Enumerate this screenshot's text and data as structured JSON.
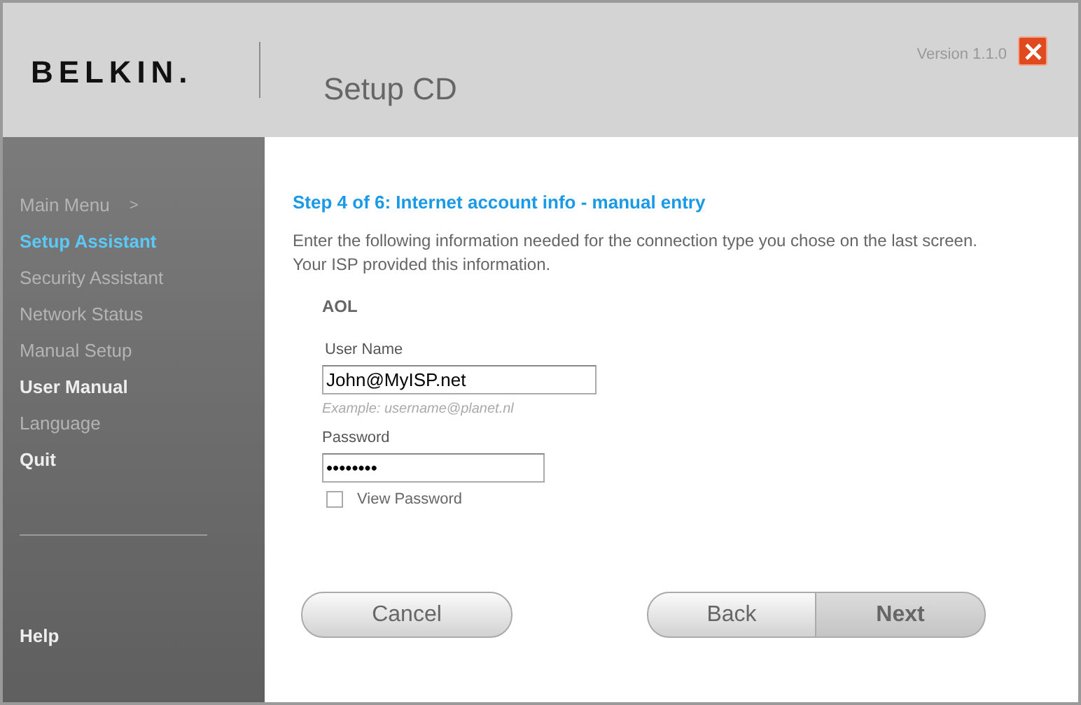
{
  "header": {
    "logo": "BELKIN.",
    "title": "Setup CD",
    "version": "Version 1.1.0"
  },
  "sidebar": {
    "items": [
      {
        "label": "Main Menu",
        "arrow": ">",
        "selected": false,
        "disabled": true
      },
      {
        "label": "Setup Assistant",
        "selected": true,
        "disabled": false
      },
      {
        "label": "Security Assistant",
        "selected": false,
        "disabled": true
      },
      {
        "label": "Network Status",
        "selected": false,
        "disabled": true
      },
      {
        "label": "Manual Setup",
        "selected": false,
        "disabled": true
      },
      {
        "label": "User Manual",
        "selected": false,
        "disabled": false
      },
      {
        "label": "Language",
        "selected": false,
        "disabled": true
      },
      {
        "label": "Quit",
        "selected": false,
        "disabled": false
      }
    ],
    "help": "Help"
  },
  "content": {
    "heading": "Step 4 of 6: Internet account info - manual entry",
    "intro": "Enter the following information needed for the connection type you chose on the last screen. Your ISP provided this information.",
    "section": "AOL",
    "user_name": {
      "label": "User Name",
      "value": "John@MyISP.net",
      "hint": "Example: username@planet.nl"
    },
    "password": {
      "label": "Password",
      "value": "••••••••"
    },
    "view_password": {
      "label": "View Password",
      "checked": false
    }
  },
  "buttons": {
    "cancel": "Cancel",
    "nav": [
      {
        "label": "Back",
        "primary": false
      },
      {
        "label": "Next",
        "primary": true
      }
    ]
  }
}
